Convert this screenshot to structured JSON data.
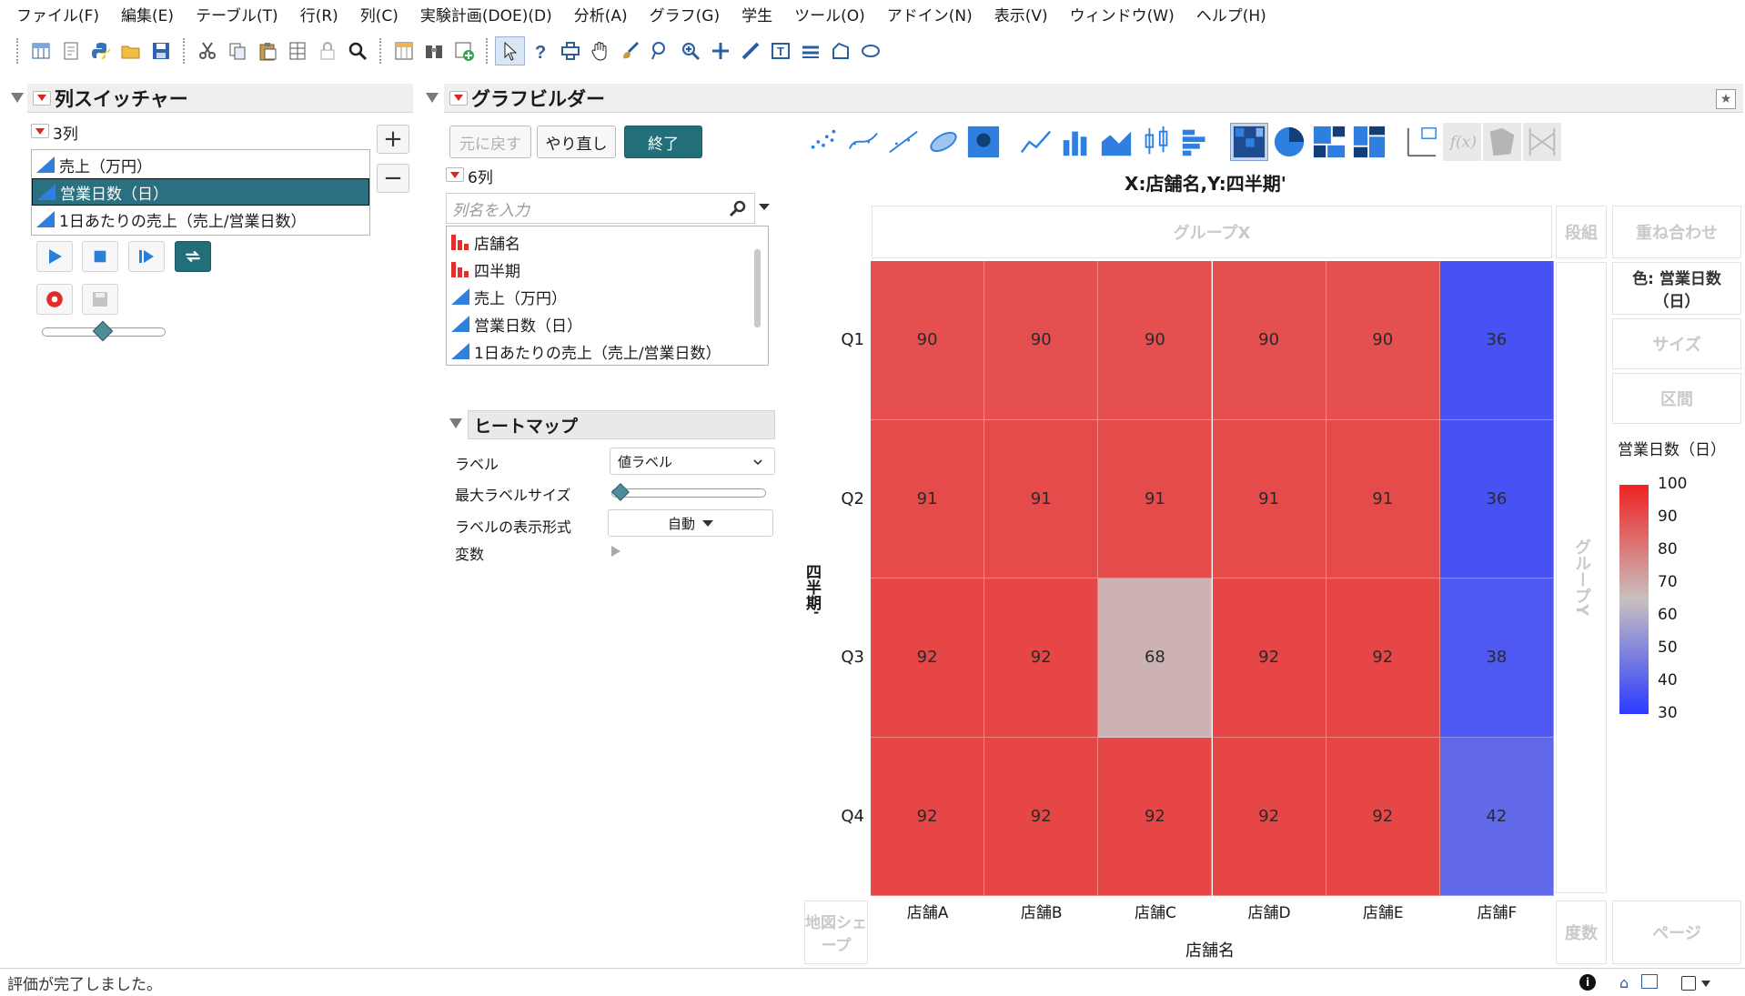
{
  "menu": [
    "ファイル(F)",
    "編集(E)",
    "テーブル(T)",
    "行(R)",
    "列(C)",
    "実験計画(DOE)(D)",
    "分析(A)",
    "グラフ(G)",
    "学生",
    "ツール(O)",
    "アドイン(N)",
    "表示(V)",
    "ウィンドウ(W)",
    "ヘルプ(H)"
  ],
  "toolbar_icons": [
    "new-table-icon",
    "new-script-icon",
    "python-icon",
    "open-icon",
    "save-icon",
    "cut-icon",
    "copy-icon",
    "paste-icon",
    "spreadsheet-icon",
    "lock-icon",
    "search-icon",
    "data-table-icon",
    "journal-icon",
    "add-icon",
    "arrow-icon",
    "help-icon",
    "crosshair-icon",
    "hand-icon",
    "brush-icon",
    "lasso-icon",
    "zoom-icon",
    "plus-icon",
    "ruler-icon",
    "text-icon",
    "line-icon",
    "polygon-icon",
    "ellipse-icon"
  ],
  "column_switcher": {
    "title": "列スイッチャー",
    "count": "3列",
    "items": [
      {
        "label": "売上（万円）",
        "selected": false
      },
      {
        "label": "営業日数（日）",
        "selected": true
      },
      {
        "label": "1日あたりの売上（売上/営業日数）",
        "selected": false
      }
    ],
    "add": "+",
    "remove": "−"
  },
  "graph_builder": {
    "title": "グラフビルダー",
    "undo": "元に戻す",
    "redo": "やり直し",
    "done": "終了",
    "col_count": "6列",
    "search_placeholder": "列名を入力",
    "columns": [
      {
        "label": "店舗名",
        "type": "nominal"
      },
      {
        "label": "四半期",
        "type": "nominal"
      },
      {
        "label": "売上（万円）",
        "type": "continuous"
      },
      {
        "label": "営業日数（日）",
        "type": "continuous"
      },
      {
        "label": "1日あたりの売上（売上/営業日数）",
        "type": "continuous"
      }
    ],
    "heatmap_section": {
      "title": "ヒートマップ",
      "label_label": "ラベル",
      "label_value": "値ラベル",
      "max_label_size": "最大ラベルサイズ",
      "label_format": "ラベルの表示形式",
      "label_format_value": "自動",
      "variables": "変数"
    },
    "zones": {
      "group_x": "グループX",
      "wrap": "段組",
      "overlay": "重ね合わせ",
      "color": "色: 営業日数（日）",
      "size": "サイズ",
      "interval": "区間",
      "group_y": "グループY",
      "map_shape": "地図シェープ",
      "freq": "度数",
      "page": "ページ"
    }
  },
  "chart_data": {
    "type": "heatmap",
    "title": "X:店舗名,Y:四半期'",
    "xlabel": "店舗名",
    "ylabel": "四半期'",
    "categories": [
      "店舗A",
      "店舗B",
      "店舗C",
      "店舗D",
      "店舗E",
      "店舗F"
    ],
    "rows": [
      "Q1",
      "Q2",
      "Q3",
      "Q4"
    ],
    "values": [
      [
        90,
        90,
        90,
        90,
        90,
        36
      ],
      [
        91,
        91,
        91,
        91,
        91,
        36
      ],
      [
        92,
        92,
        68,
        92,
        92,
        38
      ],
      [
        92,
        92,
        92,
        92,
        92,
        42
      ]
    ],
    "legend": {
      "title": "営業日数（日）",
      "ticks": [
        "100",
        "90",
        "80",
        "70",
        "60",
        "50",
        "40",
        "30"
      ],
      "range": [
        30,
        100
      ],
      "low_color": "#2b3bff",
      "mid_color": "#c9c0c0",
      "high_color": "#f02222"
    }
  },
  "status": "評価が完了しました。"
}
